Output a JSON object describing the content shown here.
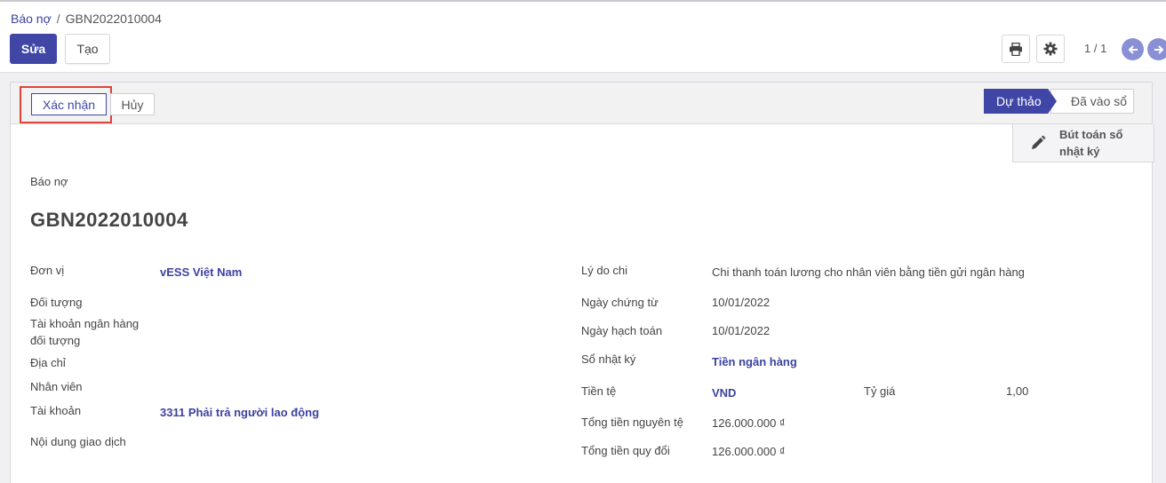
{
  "breadcrumb": {
    "parent": "Báo nợ",
    "separator": "/",
    "current": "GBN2022010004"
  },
  "toolbar": {
    "edit_label": "Sửa",
    "create_label": "Tạo"
  },
  "icons": {
    "print": "printer-icon",
    "settings": "gear-icon",
    "prev": "arrow-left-icon",
    "next": "arrow-right-icon",
    "edit": "pencil-icon"
  },
  "pager": {
    "value": "1 / 1"
  },
  "status_bar": {
    "confirm_label": "Xác nhận",
    "cancel_label": "Hủy",
    "stages": [
      {
        "label": "Dự thảo",
        "active": true
      },
      {
        "label": "Đã vào sổ",
        "active": false
      }
    ]
  },
  "smart_button": {
    "label": "Bút toán sổ nhật ký"
  },
  "document": {
    "type_label": "Báo nợ",
    "name": "GBN2022010004"
  },
  "left_fields": {
    "don_vi": {
      "label": "Đơn vị",
      "value": "vESS Việt Nam"
    },
    "doi_tuong": {
      "label": "Đối tượng",
      "value": ""
    },
    "tai_khoan_ngan_hang": {
      "label": "Tài khoản ngân hàng đối tượng",
      "value": ""
    },
    "dia_chi": {
      "label": "Địa chỉ",
      "value": ""
    },
    "nhan_vien": {
      "label": "Nhân viên",
      "value": ""
    },
    "tai_khoan": {
      "label": "Tài khoản",
      "value": "3311 Phải trả người lao động"
    },
    "noi_dung": {
      "label": "Nội dung giao dịch",
      "value": ""
    }
  },
  "right_fields": {
    "ly_do_chi": {
      "label": "Lý do chi",
      "value": "Chi thanh toán lương cho nhân viên bằng tiền gửi ngân hàng"
    },
    "ngay_chung_tu": {
      "label": "Ngày chứng từ",
      "value": "10/01/2022"
    },
    "ngay_hach_toan": {
      "label": "Ngày hạch toán",
      "value": "10/01/2022"
    },
    "so_nhat_ky": {
      "label": "Sổ nhật ký",
      "value": "Tiền ngân hàng"
    },
    "tien_te": {
      "label": "Tiền tệ",
      "value": "VND"
    },
    "ty_gia": {
      "label": "Tỷ giá",
      "value": "1,00"
    },
    "tong_nguyen_te": {
      "label": "Tổng tiền nguyên tệ",
      "value": "126.000.000 ₫"
    },
    "tong_quy_doi": {
      "label": "Tổng tiền quy đổi",
      "value": "126.000.000 ₫"
    }
  },
  "colors": {
    "primary": "#3f46a6",
    "highlight": "#e0433a",
    "nav_button": "#8a90d6"
  }
}
